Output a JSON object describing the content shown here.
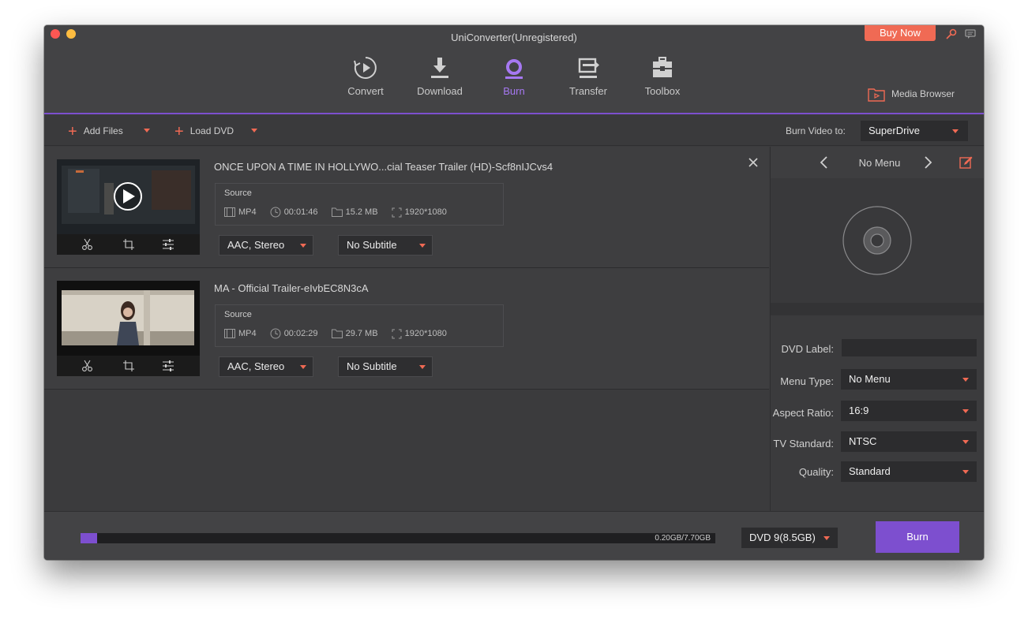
{
  "window": {
    "title": "UniConverter(Unregistered)"
  },
  "header": {
    "buy_now": "Buy Now",
    "media_browser": "Media Browser",
    "nav": [
      {
        "label": "Convert",
        "icon": "convert-icon",
        "active": false
      },
      {
        "label": "Download",
        "icon": "download-icon",
        "active": false
      },
      {
        "label": "Burn",
        "icon": "burn-icon",
        "active": true
      },
      {
        "label": "Transfer",
        "icon": "transfer-icon",
        "active": false
      },
      {
        "label": "Toolbox",
        "icon": "toolbox-icon",
        "active": false
      }
    ]
  },
  "toolbar": {
    "add_files": "Add Files",
    "load_dvd": "Load DVD",
    "burn_to_label": "Burn Video to:",
    "burn_to_value": "SuperDrive"
  },
  "videos": [
    {
      "title": "ONCE UPON A TIME IN HOLLYWO...cial Teaser Trailer (HD)-Scf8nIJCvs4",
      "source_label": "Source",
      "format": "MP4",
      "duration": "00:01:46",
      "size": "15.2 MB",
      "resolution": "1920*1080",
      "audio": "AAC, Stereo",
      "subtitle": "No Subtitle"
    },
    {
      "title": "MA - Official Trailer-eIvbEC8N3cA",
      "source_label": "Source",
      "format": "MP4",
      "duration": "00:02:29",
      "size": "29.7 MB",
      "resolution": "1920*1080",
      "audio": "AAC, Stereo",
      "subtitle": "No Subtitle"
    }
  ],
  "panel": {
    "menu_title": "No Menu",
    "dvd_label": "DVD Label:",
    "menu_type_label": "Menu Type:",
    "menu_type_value": "No Menu",
    "aspect_label": "Aspect Ratio:",
    "aspect_value": "16:9",
    "tv_label": "TV Standard:",
    "tv_value": "NTSC",
    "quality_label": "Quality:",
    "quality_value": "Standard"
  },
  "footer": {
    "progress_fraction": 0.026,
    "progress_text": "0.20GB/7.70GB",
    "disc_type": "DVD 9(8.5GB)",
    "burn": "Burn"
  },
  "colors": {
    "accent": "#7d4fcf",
    "highlight": "#f06a54"
  }
}
